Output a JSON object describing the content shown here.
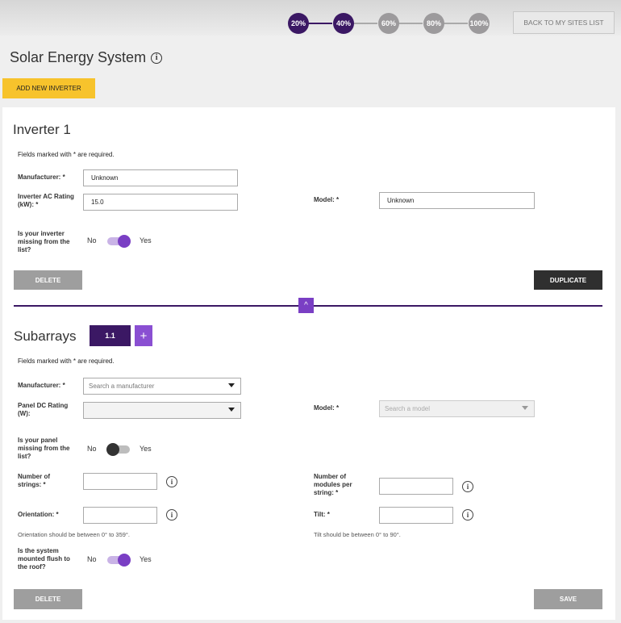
{
  "progress": {
    "steps": [
      "20%",
      "40%",
      "60%",
      "80%",
      "100%"
    ],
    "completed": 2,
    "back_label": "BACK TO MY SITES LIST"
  },
  "page": {
    "title": "Solar Energy System",
    "info_glyph": "i",
    "add_inverter_label": "ADD NEW INVERTER"
  },
  "inverter": {
    "title": "Inverter 1",
    "required_note": "Fields marked with * are required.",
    "manufacturer_label": "Manufacturer: *",
    "manufacturer_value": "Unknown",
    "ac_rating_label": "Inverter AC Rating (kW): *",
    "ac_rating_value": "15.0",
    "model_label": "Model: *",
    "model_value": "Unknown",
    "missing_label": "Is your inverter missing from the list?",
    "missing_no": "No",
    "missing_yes": "Yes",
    "missing_on": true,
    "delete_label": "DELETE",
    "duplicate_label": "DUPLICATE",
    "collapse_glyph": "^"
  },
  "subarrays": {
    "title": "Subarrays",
    "tab_label": "1.1",
    "add_glyph": "+",
    "required_note": "Fields marked with * are required.",
    "manufacturer_label": "Manufacturer: *",
    "manufacturer_placeholder": "Search a manufacturer",
    "panel_rating_label": "Panel DC Rating (W):",
    "panel_rating_value": "",
    "model_label": "Model: *",
    "model_placeholder": "Search a model",
    "missing_label": "Is your panel missing from the list?",
    "missing_no": "No",
    "missing_yes": "Yes",
    "missing_on": false,
    "strings_label": "Number of strings: *",
    "strings_value": "",
    "modules_label": "Number of modules per string: *",
    "modules_value": "",
    "orientation_label": "Orientation: *",
    "orientation_value": "",
    "orientation_hint": "Orientation should be between 0° to 359°.",
    "tilt_label": "Tilt: *",
    "tilt_value": "",
    "tilt_hint": "Tilt should be between 0° to 90°.",
    "flush_label": "Is the system mounted flush to the roof?",
    "flush_no": "No",
    "flush_yes": "Yes",
    "flush_on": true,
    "delete_label": "DELETE",
    "save_label": "SAVE"
  },
  "colors": {
    "brand_purple": "#3b1864",
    "accent_purple": "#7a3fc4",
    "yellow": "#f7c32c"
  }
}
